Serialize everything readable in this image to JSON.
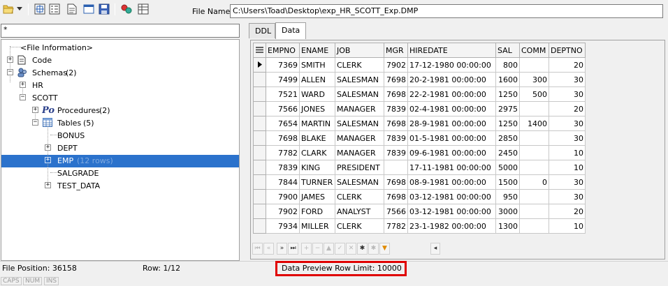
{
  "toolbar": {
    "file_name_label": "File Name",
    "file_path": "C:\\Users\\Toad\\Desktop\\exp_HR_SCOTT_Exp.DMP"
  },
  "filter": {
    "value": "*"
  },
  "tree": {
    "file_info": "<File Information>",
    "code": "Code",
    "schemas": "Schemas",
    "schemas_count": "(2)",
    "hr": "HR",
    "scott": "SCOTT",
    "procedures": "Procedures",
    "procedures_count": "(2)",
    "tables": "Tables",
    "tables_count": "(5)",
    "bonus": "BONUS",
    "dept": "DEPT",
    "emp": "EMP",
    "emp_rows": "(12 rows)",
    "salgrade": "SALGRADE",
    "test_data": "TEST_DATA"
  },
  "tabs": [
    {
      "label": "DDL"
    },
    {
      "label": "Data"
    }
  ],
  "grid": {
    "columns": [
      "EMPNO",
      "ENAME",
      "JOB",
      "MGR",
      "HIREDATE",
      "SAL",
      "COMM",
      "DEPTNO"
    ],
    "rows": [
      [
        "7369",
        "SMITH",
        "CLERK",
        "7902",
        "17-12-1980 00:00:00",
        "800",
        "",
        "20"
      ],
      [
        "7499",
        "ALLEN",
        "SALESMAN",
        "7698",
        "20-2-1981 00:00:00",
        "1600",
        "300",
        "30"
      ],
      [
        "7521",
        "WARD",
        "SALESMAN",
        "7698",
        "22-2-1981 00:00:00",
        "1250",
        "500",
        "30"
      ],
      [
        "7566",
        "JONES",
        "MANAGER",
        "7839",
        "02-4-1981 00:00:00",
        "2975",
        "",
        "20"
      ],
      [
        "7654",
        "MARTIN",
        "SALESMAN",
        "7698",
        "28-9-1981 00:00:00",
        "1250",
        "1400",
        "30"
      ],
      [
        "7698",
        "BLAKE",
        "MANAGER",
        "7839",
        "01-5-1981 00:00:00",
        "2850",
        "",
        "30"
      ],
      [
        "7782",
        "CLARK",
        "MANAGER",
        "7839",
        "09-6-1981 00:00:00",
        "2450",
        "",
        "10"
      ],
      [
        "7839",
        "KING",
        "PRESIDENT",
        "",
        "17-11-1981 00:00:00",
        "5000",
        "",
        "10"
      ],
      [
        "7844",
        "TURNER",
        "SALESMAN",
        "7698",
        "08-9-1981 00:00:00",
        "1500",
        "0",
        "30"
      ],
      [
        "7900",
        "JAMES",
        "CLERK",
        "7698",
        "03-12-1981 00:00:00",
        "950",
        "",
        "30"
      ],
      [
        "7902",
        "FORD",
        "ANALYST",
        "7566",
        "03-12-1981 00:00:00",
        "3000",
        "",
        "20"
      ],
      [
        "7934",
        "MILLER",
        "CLERK",
        "7782",
        "23-1-1982 00:00:00",
        "1300",
        "",
        "10"
      ]
    ]
  },
  "status": {
    "file_position": "File Position: 36158",
    "row": "Row: 1/12",
    "preview_limit": "Data Preview Row Limit: 10000",
    "caps": "CAPS",
    "num": "NUM",
    "ins": "INS"
  },
  "colors": {
    "selection": "#2b72cc",
    "highlight_box": "#e00000"
  }
}
